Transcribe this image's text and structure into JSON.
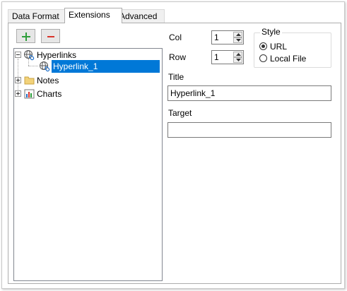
{
  "tabs": [
    {
      "label": "Data Format"
    },
    {
      "label": "Extensions"
    },
    {
      "label": "Advanced"
    }
  ],
  "toolbar": {
    "add_icon": "plus-icon",
    "remove_icon": "minus-icon"
  },
  "tree": {
    "items": [
      {
        "label": "Hyperlinks",
        "icon": "hyperlink-globe-icon",
        "expanded": true
      },
      {
        "label": "Hyperlink_1",
        "icon": "hyperlink-globe-icon",
        "selected": true
      },
      {
        "label": "Notes",
        "icon": "note-icon",
        "expanded": false
      },
      {
        "label": "Charts",
        "icon": "chart-icon",
        "expanded": false
      }
    ]
  },
  "fields": {
    "col_label": "Col",
    "col_value": "1",
    "row_label": "Row",
    "row_value": "1",
    "title_label": "Title",
    "title_value": "Hyperlink_1",
    "target_label": "Target",
    "target_value": ""
  },
  "style_group": {
    "legend": "Style",
    "options": [
      {
        "label": "URL",
        "checked": true
      },
      {
        "label": "Local File",
        "checked": false
      }
    ]
  },
  "colors": {
    "selection": "#0078d7",
    "add_green": "#2e9e3a",
    "remove_red": "#d9342b"
  }
}
